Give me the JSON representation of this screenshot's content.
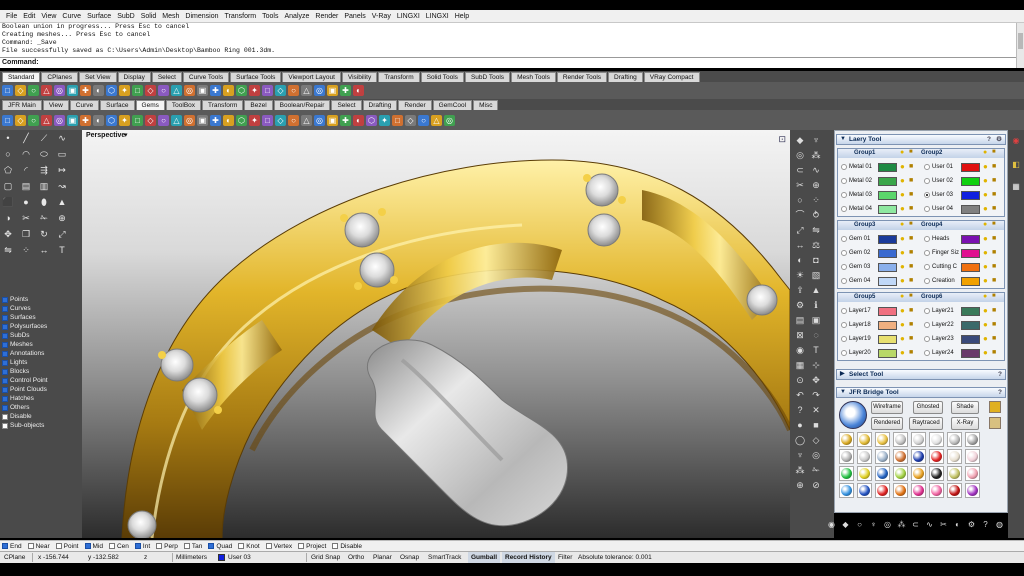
{
  "menu": [
    "File",
    "Edit",
    "View",
    "Curve",
    "Surface",
    "SubD",
    "Solid",
    "Mesh",
    "Dimension",
    "Transform",
    "Tools",
    "Analyze",
    "Render",
    "Panels",
    "V-Ray",
    "LINGXI",
    "LINGXI",
    "Help"
  ],
  "command_log": [
    "Boolean union in progress... Press Esc to cancel",
    "Creating meshes... Press Esc to cancel",
    "Command: _Save",
    "File successfully saved as C:\\Users\\Admin\\Desktop\\Bamboo Ring 001.3dm."
  ],
  "command_prompt": "Command:",
  "tabs_row1": [
    "Standard",
    "CPlanes",
    "Set View",
    "Display",
    "Select",
    "Curve Tools",
    "Surface Tools",
    "Viewport Layout",
    "Visibility",
    "Transform",
    "Solid Tools",
    "SubD Tools",
    "Mesh Tools",
    "Render Tools",
    "Drafting",
    "VRay Compact"
  ],
  "tabs_row2": [
    "JFR Main",
    "View",
    "Curve",
    "Surface",
    "Gems",
    "ToolBox",
    "Transform",
    "Bezel",
    "Boolean/Repair",
    "Select",
    "Drafting",
    "Render",
    "GemCool",
    "Misc"
  ],
  "toolbar1_icons": [
    "new-icon",
    "open-icon",
    "save-icon",
    "print-icon",
    "import-icon",
    "cut-icon",
    "copy-icon",
    "paste-icon",
    "undo-icon",
    "redo-icon",
    "pan-icon",
    "rotate-icon",
    "zoom-icon",
    "zoom-window-icon",
    "zoom-extents-icon",
    "zoom-selected-icon",
    "four-view-icon",
    "viewport-icon",
    "cplane-icon",
    "grid-icon",
    "osnap-icon",
    "shade-icon",
    "render-icon",
    "light-icon",
    "layer-icon",
    "properties-icon",
    "options-icon",
    "help-icon"
  ],
  "toolbar2_icons": [
    "gem-icon",
    "prong-icon",
    "ring-icon",
    "shank-icon",
    "bezel-icon",
    "pave-icon",
    "flow-icon",
    "array-icon",
    "cutter-icon",
    "boolean-icon",
    "mirror-icon",
    "scale-icon",
    "twist-icon",
    "bend-icon",
    "taper-icon",
    "loft-icon",
    "sweep-icon",
    "revolve-icon",
    "pipe-icon",
    "offset-icon",
    "fillet-icon",
    "chamfer-icon",
    "split-icon",
    "trim-icon",
    "join-icon",
    "explode-icon",
    "text-icon",
    "measure-icon",
    "weight-icon",
    "stl-icon",
    "render-icon",
    "camera-icon",
    "settings-icon",
    "info-icon",
    "export-icon"
  ],
  "viewport": {
    "label": "Perspective"
  },
  "select_filters": [
    {
      "label": "Points",
      "on": true
    },
    {
      "label": "Curves",
      "on": true
    },
    {
      "label": "Surfaces",
      "on": true
    },
    {
      "label": "Polysurfaces",
      "on": true
    },
    {
      "label": "SubDs",
      "on": true
    },
    {
      "label": "Meshes",
      "on": true
    },
    {
      "label": "Annotations",
      "on": true
    },
    {
      "label": "Lights",
      "on": true
    },
    {
      "label": "Blocks",
      "on": true
    },
    {
      "label": "Control Point",
      "on": true
    },
    {
      "label": "Point Clouds",
      "on": true
    },
    {
      "label": "Hatches",
      "on": true
    },
    {
      "label": "Others",
      "on": true
    },
    {
      "label": "Disable",
      "on": false
    },
    {
      "label": "Sub-objects",
      "on": false
    }
  ],
  "panel": {
    "laery_title": "Laery Tool",
    "groups": [
      {
        "left_title": "Group1",
        "right_title": "Group2",
        "left": [
          {
            "name": "Metal 01",
            "color": "#1e8a44"
          },
          {
            "name": "Metal 02",
            "color": "#3aa64a"
          },
          {
            "name": "Metal 03",
            "color": "#5cd66c"
          },
          {
            "name": "Metal 04",
            "color": "#8ee8a0"
          }
        ],
        "right": [
          {
            "name": "User 01",
            "color": "#e01010"
          },
          {
            "name": "User 02",
            "color": "#10d010"
          },
          {
            "name": "User 03",
            "color": "#1020e0",
            "on": true
          },
          {
            "name": "User 04",
            "color": "#808080"
          }
        ]
      },
      {
        "left_title": "Group3",
        "right_title": "Group4",
        "left": [
          {
            "name": "Gem 01",
            "color": "#1a3a9a"
          },
          {
            "name": "Gem 02",
            "color": "#3a6ad0"
          },
          {
            "name": "Gem 03",
            "color": "#8ab0ec"
          },
          {
            "name": "Gem 04",
            "color": "#c0d8f8"
          }
        ],
        "right": [
          {
            "name": "Heads",
            "color": "#7a10b0"
          },
          {
            "name": "Finger Siz",
            "color": "#e01090"
          },
          {
            "name": "Cutting C",
            "color": "#f07010"
          },
          {
            "name": "Creation",
            "color": "#f0a000"
          }
        ]
      },
      {
        "left_title": "Group5",
        "right_title": "Group6",
        "left": [
          {
            "name": "Layer17",
            "color": "#f07080"
          },
          {
            "name": "Layer18",
            "color": "#f0b080"
          },
          {
            "name": "Layer19",
            "color": "#e8e070"
          },
          {
            "name": "Layer20",
            "color": "#b8d868"
          }
        ],
        "right": [
          {
            "name": "Layer21",
            "color": "#3a7a5a"
          },
          {
            "name": "Layer22",
            "color": "#3a6a6a"
          },
          {
            "name": "Layer23",
            "color": "#3a4a7a"
          },
          {
            "name": "Layer24",
            "color": "#6a3a6a"
          }
        ]
      }
    ],
    "select_title": "Select Tool",
    "bridge_title": "JFR Bridge Tool",
    "bridge_buttons": [
      "Wireframe",
      "Ghosted",
      "Shade",
      "Rendered",
      "Raytraced",
      "X-Ray"
    ],
    "material_colors": [
      "#d8a820",
      "#e0b830",
      "#e8c040",
      "#c0c0c0",
      "#d0d0d0",
      "#e0e0e0",
      "#b8b8b8",
      "#a0a0a0",
      "#b0b0b0",
      "#c8c8c8",
      "#9ab0c8",
      "#d07030",
      "#1a3aaa",
      "#e02020",
      "#e8e0d0",
      "#f0d0d8",
      "#20c040",
      "#e0d020",
      "#2060c0",
      "#a0d040",
      "#e8a020",
      "#202020",
      "#c0c060",
      "#f0a0b0",
      "#3090e0",
      "#2050c0",
      "#e02020",
      "#e07010",
      "#e03090",
      "#f060a0",
      "#c01010",
      "#a030c0"
    ]
  },
  "osnaps": [
    {
      "label": "End",
      "on": true
    },
    {
      "label": "Near",
      "on": false
    },
    {
      "label": "Point",
      "on": false
    },
    {
      "label": "Mid",
      "on": true
    },
    {
      "label": "Cen",
      "on": false
    },
    {
      "label": "Int",
      "on": true
    },
    {
      "label": "Perp",
      "on": false
    },
    {
      "label": "Tan",
      "on": false
    },
    {
      "label": "Quad",
      "on": true
    },
    {
      "label": "Knot",
      "on": false
    },
    {
      "label": "Vertex",
      "on": false
    },
    {
      "label": "Project",
      "on": false
    },
    {
      "label": "Disable",
      "on": false
    }
  ],
  "status": {
    "cplane": "CPlane",
    "x": "x -156.744",
    "y": "y -132.582",
    "z": "z",
    "units": "Millimeters",
    "layer": "User 03",
    "layer_color": "#1020e0",
    "grid_snap": "Grid Snap",
    "ortho": "Ortho",
    "planar": "Planar",
    "osnap": "Osnap",
    "smarttrack": "SmartTrack",
    "gumball": "Gumball",
    "record_history": "Record History",
    "filter": "Filter",
    "tolerance": "Absolute tolerance: 0.001"
  }
}
